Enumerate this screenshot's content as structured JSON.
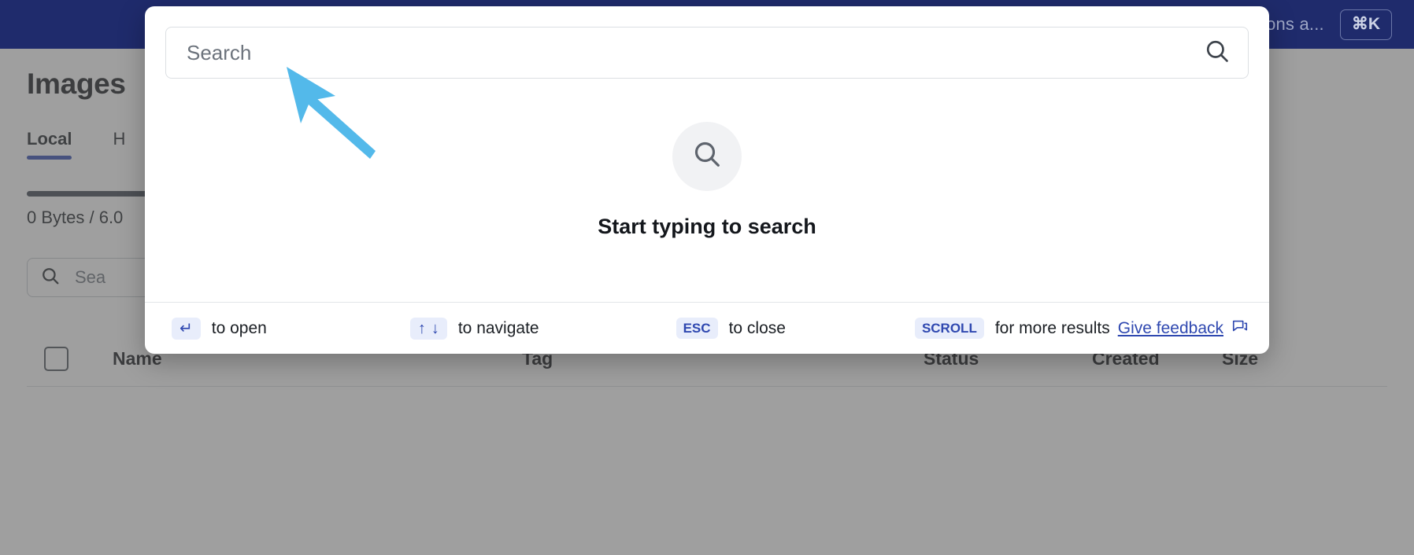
{
  "top_nav": {
    "search_hint": "ons a...",
    "shortcut_badge": "⌘K",
    "bar_color": "#1f2b6c"
  },
  "page": {
    "title": "Images",
    "tabs": [
      {
        "label": "Local",
        "active": true
      },
      {
        "label": "H",
        "active": false
      }
    ],
    "storage": {
      "label": "0 Bytes / 6.0"
    },
    "table_search": {
      "placeholder": "Sea",
      "icon": "search-icon"
    },
    "table": {
      "columns": [
        {
          "key": "name",
          "label": "Name"
        },
        {
          "key": "tag",
          "label": "Tag"
        },
        {
          "key": "status",
          "label": "Status"
        },
        {
          "key": "created",
          "label": "Created"
        },
        {
          "key": "size",
          "label": "Size"
        }
      ],
      "rows": []
    }
  },
  "command_palette": {
    "search": {
      "placeholder": "Search",
      "value": "",
      "icon": "search-icon"
    },
    "empty_state": {
      "icon": "search-icon",
      "title": "Start typing to search"
    },
    "footer": {
      "open": {
        "key": "↵",
        "label": "to open"
      },
      "navigate": {
        "key_up": "↑",
        "key_down": "↓",
        "label": "to navigate"
      },
      "close": {
        "key": "ESC",
        "label": "to close"
      },
      "scroll": {
        "key": "SCROLL",
        "label": "for more results"
      },
      "feedback": {
        "label": "Give feedback",
        "icon": "feedback-chat-icon"
      }
    }
  },
  "annotation": {
    "cursor": {
      "type": "arrow-pointer",
      "color": "#53b9ea"
    }
  }
}
